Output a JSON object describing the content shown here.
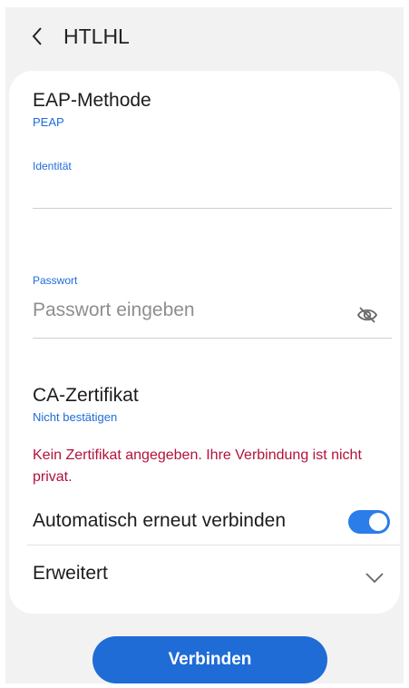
{
  "header": {
    "title": "HTLHL"
  },
  "eap": {
    "label": "EAP-Methode",
    "value": "PEAP"
  },
  "identity": {
    "label": "Identität",
    "value": ""
  },
  "password": {
    "label": "Passwort",
    "placeholder": "Passwort eingeben"
  },
  "ca": {
    "label": "CA-Zertifikat",
    "value": "Nicht bestätigen"
  },
  "warning": {
    "text": "Kein Zertifikat angegeben. Ihre Verbindung ist nicht privat."
  },
  "auto_reconnect": {
    "label": "Automatisch erneut verbinden",
    "enabled": true
  },
  "advanced": {
    "label": "Erweitert"
  },
  "connect_button": {
    "label": "Verbinden"
  },
  "colors": {
    "accent": "#1f6cd7",
    "error": "#b3123a",
    "toggle_on": "#2b7de9"
  },
  "icons": [
    "back-arrow-icon",
    "eye-off-icon",
    "chevron-down-icon"
  ]
}
